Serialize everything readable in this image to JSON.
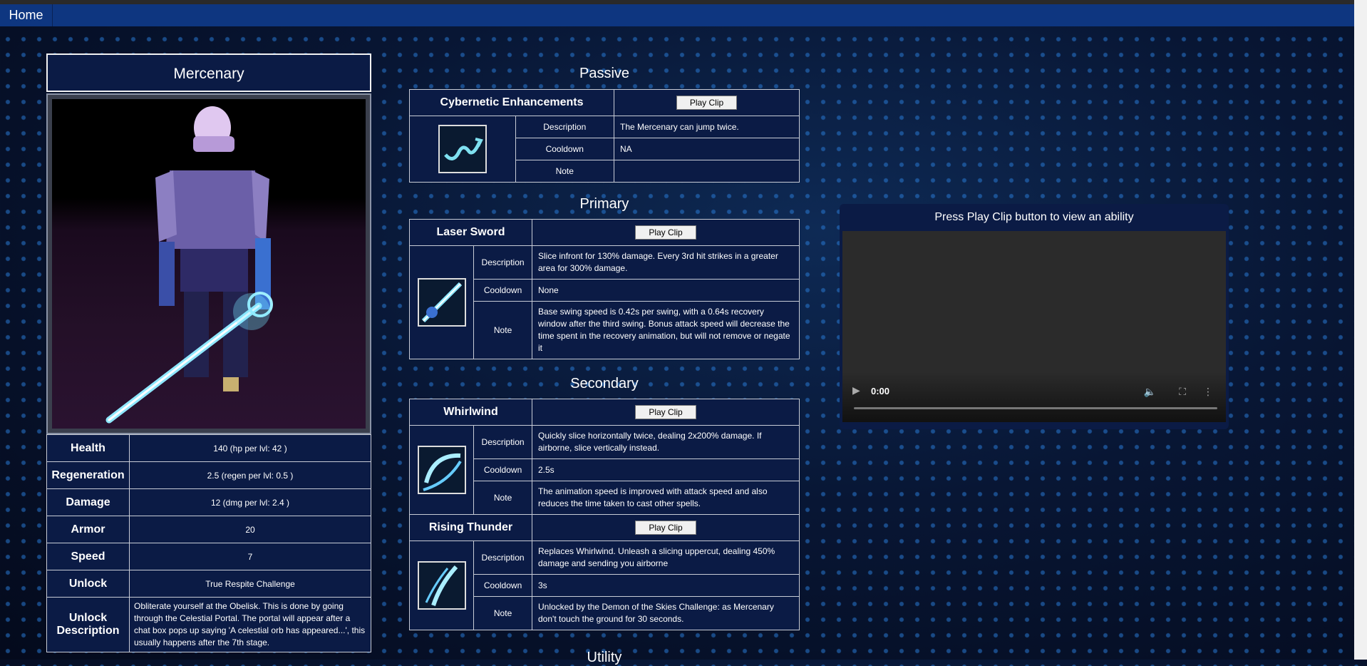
{
  "nav": {
    "home": "Home"
  },
  "character": {
    "name": "Mercenary",
    "stats": [
      {
        "label": "Health",
        "value": "140 (hp per lvl: 42 )"
      },
      {
        "label": "Regeneration",
        "value": "2.5 (regen per lvl: 0.5 )"
      },
      {
        "label": "Damage",
        "value": "12 (dmg per lvl: 2.4 )"
      },
      {
        "label": "Armor",
        "value": "20"
      },
      {
        "label": "Speed",
        "value": "7"
      },
      {
        "label": "Unlock",
        "value": "True Respite Challenge"
      },
      {
        "label": "Unlock Description",
        "value": "Obliterate yourself at the Obelisk. This is done by going through the Celestial Portal. The portal will appear after a chat box pops up saying 'A celestial orb has appeared...', this usually happens after the 7th stage."
      }
    ]
  },
  "labels": {
    "description": "Description",
    "cooldown": "Cooldown",
    "note": "Note",
    "play_clip": "Play Clip"
  },
  "sections": {
    "passive": "Passive",
    "primary": "Primary",
    "secondary": "Secondary",
    "utility": "Utility"
  },
  "abilities": {
    "cybernetic": {
      "name": "Cybernetic Enhancements",
      "description": "The Mercenary can jump twice.",
      "cooldown": "NA",
      "note": ""
    },
    "laser_sword": {
      "name": "Laser Sword",
      "description": "Slice infront for 130% damage. Every 3rd hit strikes in a greater area for 300% damage.",
      "cooldown": "None",
      "note": "Base swing speed is 0.42s per swing, with a 0.64s recovery window after the third swing. Bonus attack speed will decrease the time spent in the recovery animation, but will not remove or negate it"
    },
    "whirlwind": {
      "name": "Whirlwind",
      "description": "Quickly slice horizontally twice, dealing 2x200% damage. If airborne, slice vertically instead.",
      "cooldown": "2.5s",
      "note": "The animation speed is improved with attack speed and also reduces the time taken to cast other spells."
    },
    "rising_thunder": {
      "name": "Rising Thunder",
      "description": "Replaces Whirlwind. Unleash a slicing uppercut, dealing 450% damage and sending you airborne",
      "cooldown": "3s",
      "note": "Unlocked by the Demon of the Skies Challenge: as Mercenary don't touch the ground for 30 seconds."
    }
  },
  "video": {
    "title": "Press Play Clip button to view an ability",
    "time": "0:00"
  }
}
